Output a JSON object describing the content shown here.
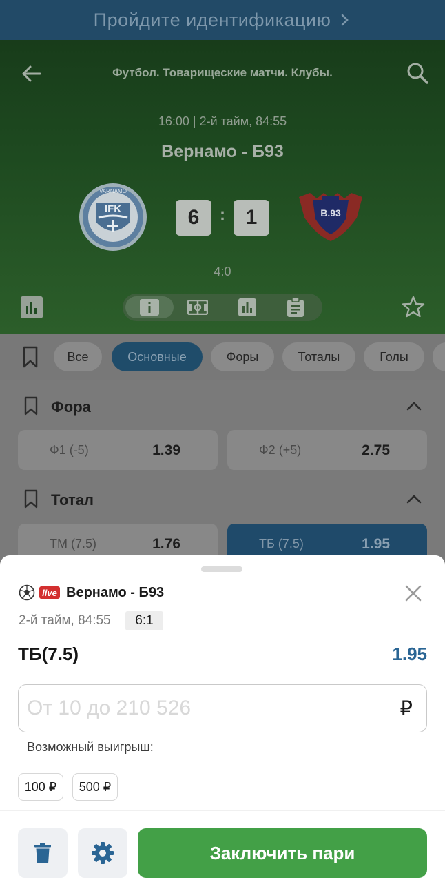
{
  "banner": {
    "text": "Пройдите идентификацию"
  },
  "match": {
    "league": "Футбол. Товарищеские матчи. Клубы.",
    "time_line": "16:00  |  2-й тайм, 84:55",
    "title": "Вернамо - Б93",
    "score_home": "6",
    "score_away": "1",
    "score_sep": ":",
    "half_score": "4:0",
    "home_logo_text": "IFK",
    "home_logo_ring": "VARNAMO",
    "away_logo_text": "B.93"
  },
  "tabs": [
    "Все",
    "Основные",
    "Форы",
    "Тоталы",
    "Голы"
  ],
  "active_tab": "Основные",
  "markets": [
    {
      "title": "Фора",
      "odds": [
        {
          "label": "Ф1 (-5)",
          "value": "1.39"
        },
        {
          "label": "Ф2 (+5)",
          "value": "2.75"
        }
      ]
    },
    {
      "title": "Тотал",
      "odds": [
        {
          "label": "ТМ (7.5)",
          "value": "1.76"
        },
        {
          "label": "ТБ (7.5)",
          "value": "1.95"
        }
      ]
    }
  ],
  "coupon": {
    "live_badge": "live",
    "match": "Вернамо - Б93",
    "time": "2-й тайм, 84:55",
    "score": "6:1",
    "bet_name": "ТБ(7.5)",
    "bet_odd": "1.95",
    "amount_placeholder": "От 10 до 210 526",
    "currency": "₽",
    "possible_win_label": "Возможный выигрыш:",
    "quick_amounts": [
      "100 ₽",
      "500 ₽"
    ],
    "submit_label": "Заключить пари"
  },
  "colors": {
    "brand_blue": "#1f4c6a",
    "accent_green": "#43a047",
    "odd_blue": "#2a6594",
    "live_red": "#d32f2f"
  },
  "icons": [
    "chevron-right-icon",
    "back-arrow-icon",
    "search-icon",
    "stats-icon",
    "info-icon",
    "field-icon",
    "bar-chart-icon",
    "clipboard-icon",
    "star-icon",
    "bookmark-icon",
    "chevron-up-icon",
    "soccer-ball-icon",
    "close-icon",
    "trash-icon",
    "gear-icon"
  ]
}
